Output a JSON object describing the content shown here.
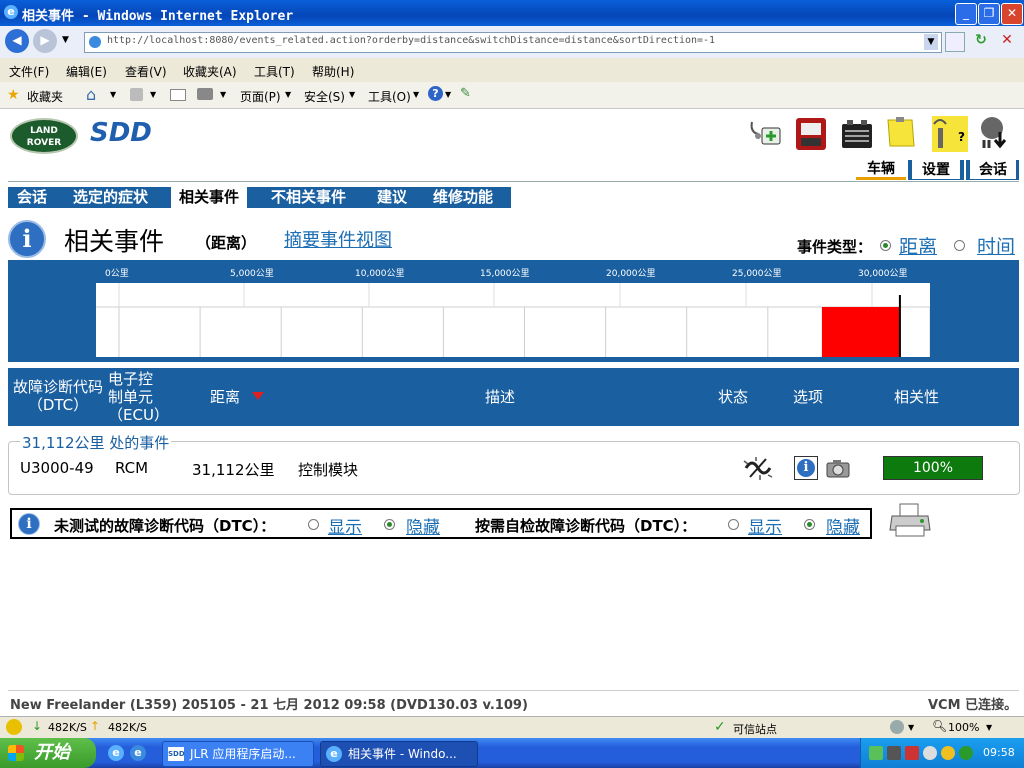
{
  "window": {
    "title": "相关事件 - Windows Internet Explorer"
  },
  "browser": {
    "address": "http://localhost:8080/events_related.action?orderby=distance&switchDistance=distance&sortDirection=-1",
    "menu": [
      "文件(F)",
      "编辑(E)",
      "查看(V)",
      "收藏夹(A)",
      "工具(T)",
      "帮助(H)"
    ],
    "favorites_label": "收藏夹",
    "cmd_page": "页面(P)",
    "cmd_safety": "安全(S)",
    "cmd_tools": "工具(O)"
  },
  "app": {
    "logo_text": "LAND ROVER",
    "brand": "SDD",
    "top_icons": [
      "first-aid-icon",
      "vcm-icon",
      "battery-icon",
      "note-icon",
      "wireless-help-icon",
      "network-download-icon"
    ],
    "vertical_tabs": [
      {
        "label": "车辆",
        "active": true
      },
      {
        "label": "设置",
        "active": false
      },
      {
        "label": "会话",
        "active": false
      }
    ],
    "nav_tabs": [
      {
        "label": "会话",
        "active": false
      },
      {
        "label": "选定的症状",
        "active": false
      },
      {
        "label": "相关事件",
        "active": true
      },
      {
        "label": "不相关事件",
        "active": false
      },
      {
        "label": "建议",
        "active": false
      },
      {
        "label": "维修功能",
        "active": false
      }
    ]
  },
  "heading": {
    "title": "相关事件",
    "subtitle": "（距离）",
    "summary_link": "摘要事件视图",
    "event_type_label": "事件类型：",
    "option_distance": "距离",
    "option_time": "时间",
    "selected": "distance"
  },
  "chart_data": {
    "type": "bar",
    "x_ticks": [
      "0公里",
      "5,000公里",
      "10,000公里",
      "15,000公里",
      "20,000公里",
      "25,000公里",
      "30,000公里"
    ],
    "xlim": [
      0,
      32000
    ],
    "events": [
      {
        "distance": 31112,
        "color": "#ff0000"
      }
    ],
    "grid": true
  },
  "table": {
    "headers": {
      "dtc": "故障诊断代码\n（DTC）",
      "ecu": "电子控\n制单元\n（ECU）",
      "distance": "距离",
      "description": "描述",
      "status": "状态",
      "options": "选项",
      "relevance": "相关性"
    },
    "group_label": "31,112公里 处的事件",
    "rows": [
      {
        "dtc": "U3000-49",
        "ecu": "RCM",
        "distance": "31,112公里",
        "description": "控制模块",
        "relevance": "100%",
        "relevance_value": 1.0
      }
    ]
  },
  "dtc_filter": {
    "untested_label": "未测试的故障诊断代码（DTC）：",
    "ondemand_label": "按需自检故障诊断代码（DTC）：",
    "show": "显示",
    "hide": "隐藏",
    "untested_selected": "hide",
    "ondemand_selected": "hide"
  },
  "footer": {
    "vehicle_info": "New Freelander (L359) 205105 - 21 七月  2012 09:58 (DVD130.03 v.109)",
    "vcm_status": "VCM 已连接。"
  },
  "statusbar": {
    "down_speed": "482K/S",
    "up_speed": "482K/S",
    "zone": "可信站点",
    "zoom": "100%"
  },
  "taskbar": {
    "start": "开始",
    "tasks": [
      "JLR 应用程序启动...",
      "相关事件 - Windo..."
    ],
    "clock": "09:58"
  }
}
